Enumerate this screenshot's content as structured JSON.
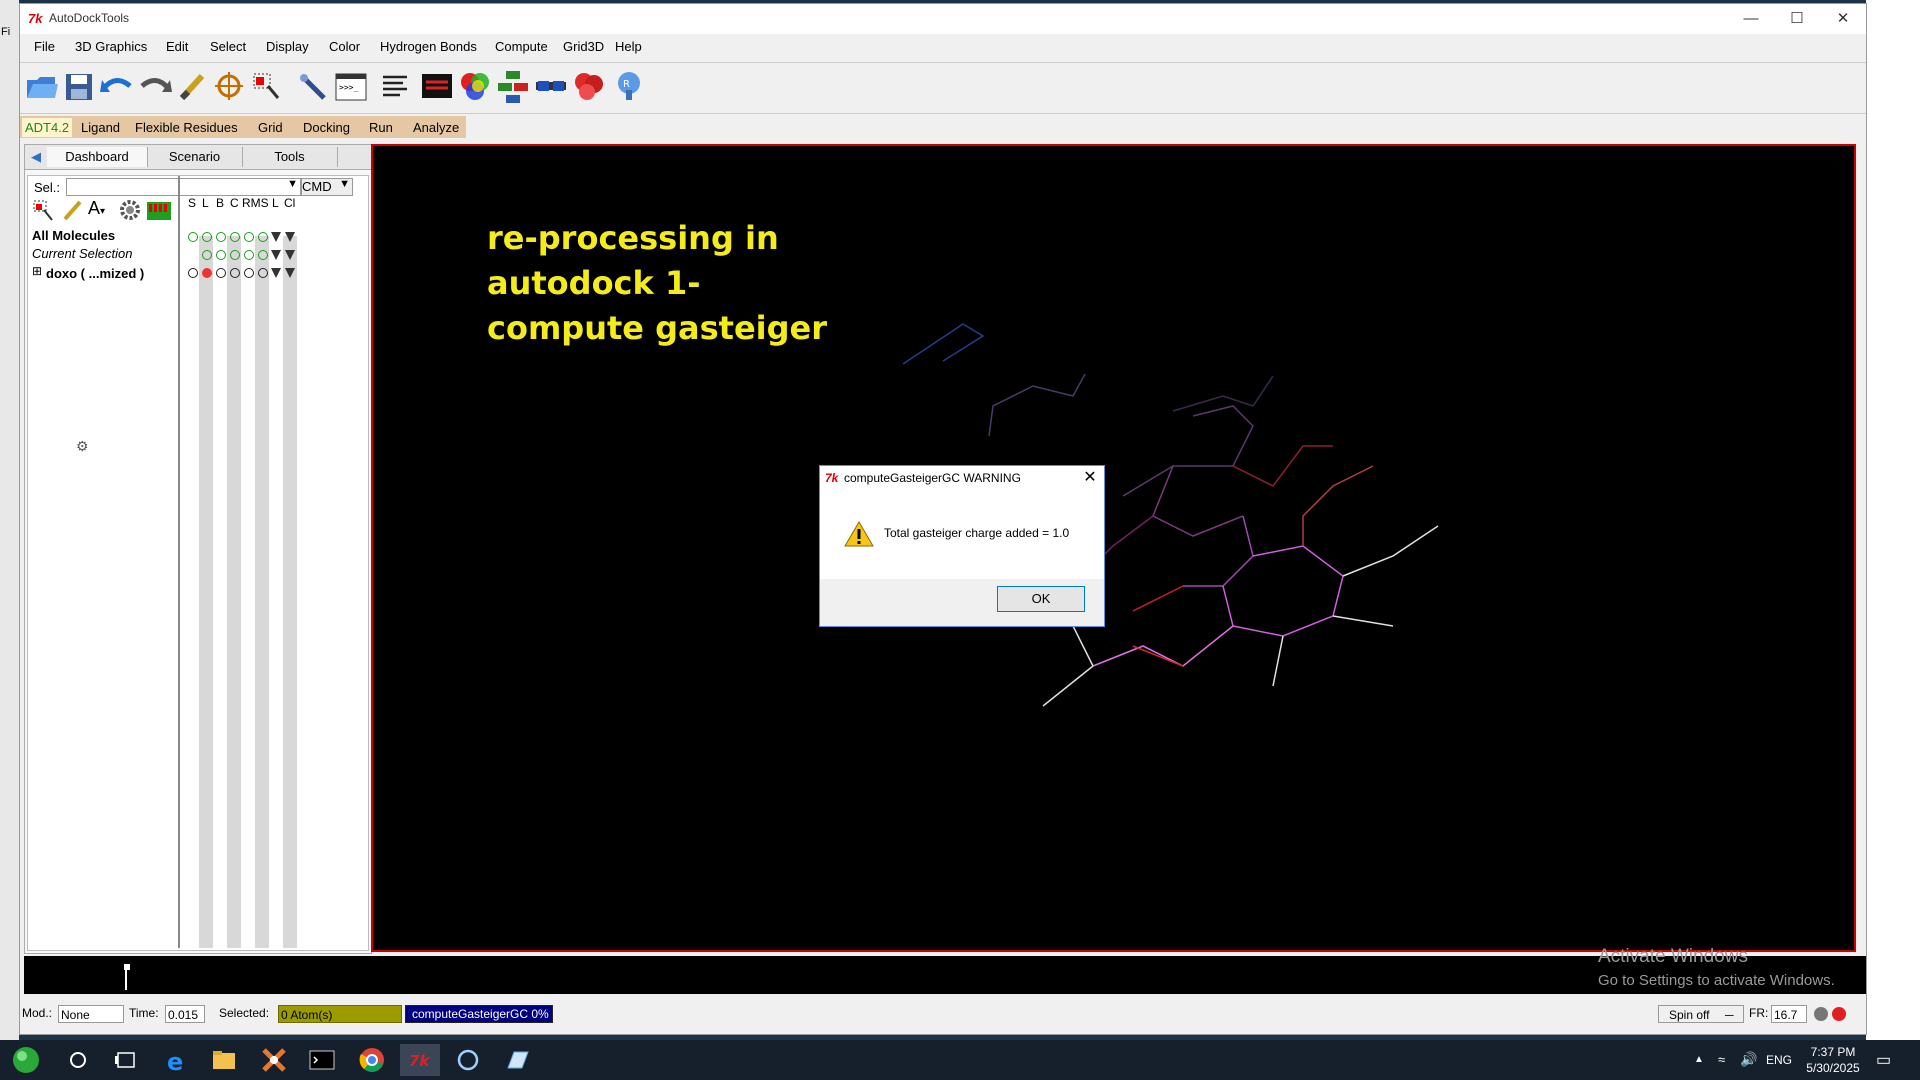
{
  "window": {
    "title": "AutoDockTools",
    "min_icon": "minimize-icon",
    "max_icon": "maximize-icon",
    "close_icon": "close-icon"
  },
  "desktop": {
    "left_fragment": "Fi"
  },
  "menubar": [
    "File",
    "3D Graphics",
    "Edit",
    "Select",
    "Display",
    "Color",
    "Hydrogen Bonds",
    "Compute",
    "Grid3D",
    "Help"
  ],
  "toolbar_icons": [
    "open-file-icon",
    "save-icon",
    "undo-icon",
    "redo-icon",
    "pick-icon",
    "center-icon",
    "select-icon",
    "measure-icon",
    "python-shell-icon",
    "text-icon",
    "display-icon",
    "color-icon",
    "hierarchy-icon",
    "stereo-glasses-icon",
    "surface-icon",
    "pmv-icon"
  ],
  "adt_tabs": [
    "ADT4.2",
    "Ligand",
    "Flexible Residues",
    "Grid",
    "Docking",
    "Run",
    "Analyze"
  ],
  "dashboard": {
    "tabs": [
      "Dashboard",
      "Scenario",
      "Tools"
    ],
    "sel_label": "Sel.:",
    "sel_value": "",
    "cmd_label": "CMD",
    "columns": [
      "S",
      "L",
      "B",
      "C",
      "RMS",
      "L",
      "Cl"
    ],
    "tree": [
      {
        "label": "All Molecules"
      },
      {
        "label": "Current Selection"
      },
      {
        "label": "doxo ( ...mized )"
      }
    ]
  },
  "viewer": {
    "overlay_lines": [
      "re-processing in",
      "autodock 1-",
      "compute gasteiger"
    ],
    "background": "#000000",
    "border": "#cc0000"
  },
  "dialog": {
    "title": "computeGasteigerGC WARNING",
    "message": "Total gasteiger charge added = 1.0",
    "ok_label": "OK"
  },
  "status": {
    "mod_label": "Mod.:",
    "mod_value": "None",
    "time_label": "Time:",
    "time_value": "0.015",
    "selected_label": "Selected:",
    "selected_value": "0 Atom(s)",
    "progress_text": "computeGasteigerGC 0%",
    "progress": 0,
    "spin_label": "Spin off",
    "fr_label": "FR:",
    "fr_value": "16.7"
  },
  "watermark": {
    "line1": "Activate Windows",
    "line2": "Go to Settings to activate Windows."
  },
  "taskbar": {
    "icons": [
      "start-icon",
      "search-icon",
      "task-view-icon",
      "edge-icon",
      "file-explorer-icon",
      "app-icon",
      "terminal-icon",
      "chrome-icon",
      "tk-icon",
      "cortana-icon",
      "notes-icon"
    ],
    "lang": "ENG",
    "time": "7:37 PM",
    "date": "5/30/2025"
  },
  "colors": {
    "accent": "#0078d7",
    "highlight_yellow": "#f4ec1a",
    "selected_bg": "#9b9b00",
    "progress_bg": "#000080"
  }
}
